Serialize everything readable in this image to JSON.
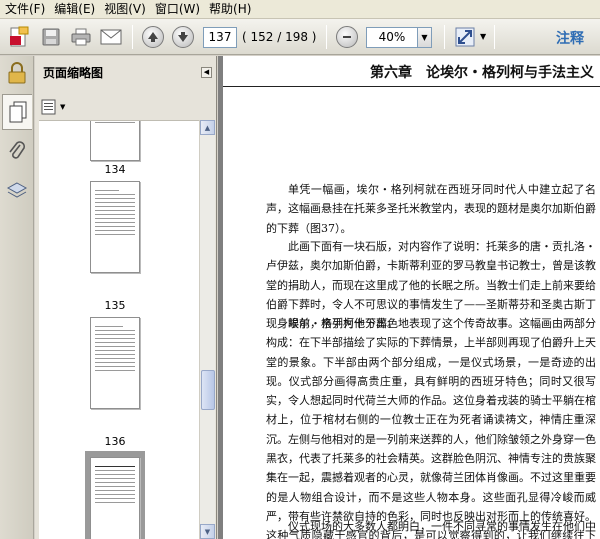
{
  "menu": [
    "文件(F)",
    "编辑(E)",
    "视图(V)",
    "窗口(W)",
    "帮助(H)"
  ],
  "toolbar": {
    "current_page": "137",
    "page_count": "( 152 / 198 )",
    "zoom": "40%",
    "annotate": "注释"
  },
  "panel": {
    "title": "页面缩略图",
    "thumbnails": [
      "134",
      "135",
      "136"
    ]
  },
  "document": {
    "chapter_title": "第六章　论埃尔・格列柯与手法主义",
    "paragraphs": [
      "单凭一幅画，埃尔・格列柯就在西班牙同时代人中建立起了名声，这幅画悬挂在托莱多圣托米教堂内，表现的题材是奥尔加斯伯爵的下葬（图37）。",
      "此画下面有一块石版，对内容作了说明：托莱多的唐・贡扎洛・卢伊兹，奥尔加斯伯爵，卡斯蒂利亚的罗马教皇书记教士，曾是该教堂的捐助人，而现在这里成了他的长眠之所。当教士们走上前来要给伯爵下葬时，令人不可思议的事情发生了——圣斯蒂芬和圣奥古斯丁现身眼前，亲手为他下葬。",
      "埃尔・格列柯十分出色地表现了这个传奇故事。这幅画由两部分构成：在下半部描绘了实际的下葬情景，上半部则再现了伯爵升上天堂的景象。下半部由两个部分组成，一是仪式场景，一是奇迹的出现。仪式部分画得高贵庄重，具有鲜明的西班牙特色；同时又很写实，令人想起同时代荷兰大师的作品。这位身着戎装的骑士平躺在棺材上，位于棺材右侧的一位教士正在为死者诵读祷文，神情庄重深沉。左侧与他相对的是一列前来送葬的人，他们除皱领之外身穿一色黑衣，代表了托莱多的社会精英。这群脸色阴沉、神情专注的贵族聚集在一起，震撼着观者的心灵，就像荷兰团体肖像画。不过这里重要的是人物组合设计，而不是这些人物本身。这些面孔显得冷峻而威严，带有些许禁欲自持的色彩，同时也反映出对形而上的传统喜好。这种气质隐藏于感官的背后，是可以觉察得到的，让我们继续往下看。",
      "仪式现场的大多数人都明白，一件不同寻常的事情发生在他们中间。"
    ]
  }
}
